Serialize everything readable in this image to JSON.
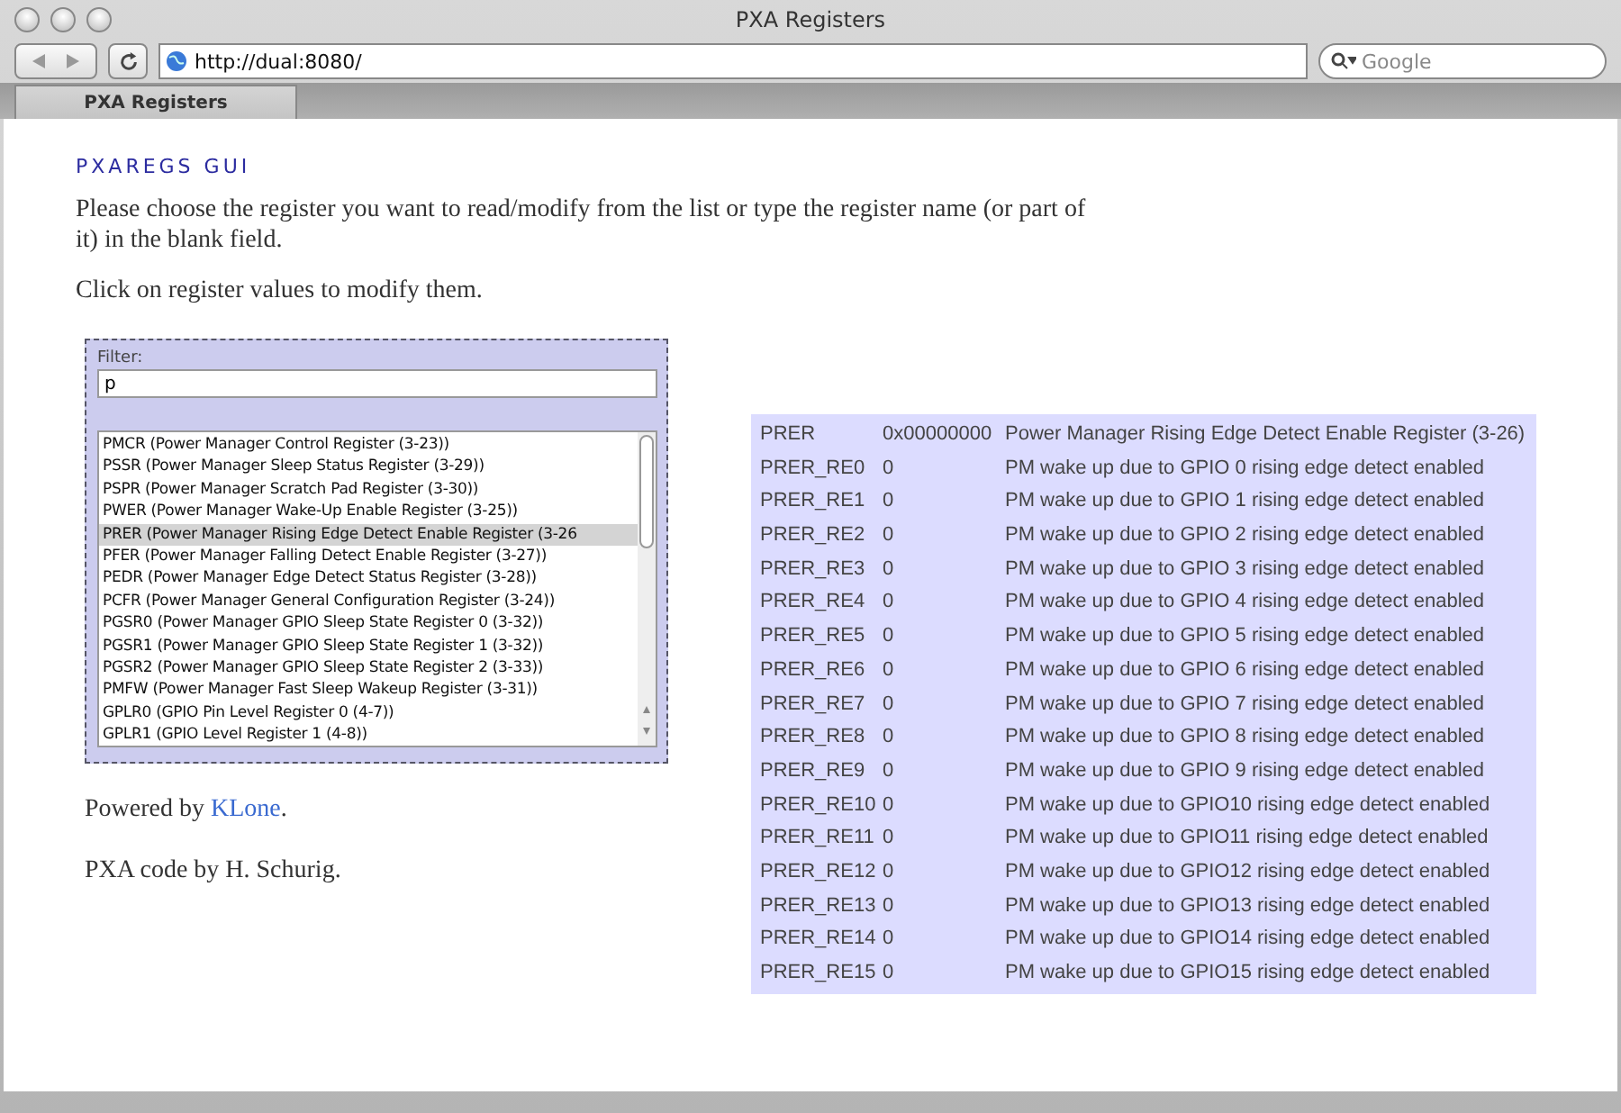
{
  "window": {
    "title": "PXA Registers"
  },
  "toolbar": {
    "url": "http://dual:8080/",
    "search": {
      "placeholder": "Google"
    }
  },
  "tabs": [
    {
      "label": "PXA Registers",
      "selected": true
    }
  ],
  "page": {
    "heading": "PXAREGS GUI",
    "paragraphs": [
      "Please choose the register you want to read/modify from the list or type the register name (or part of it) in the blank field.",
      "Click on register values to modify them."
    ],
    "filter": {
      "label": "Filter:",
      "value": "p"
    },
    "registers": [
      {
        "label": "PMCR (Power Manager Control Register (3-23))",
        "selected": false
      },
      {
        "label": "PSSR (Power Manager Sleep Status Register (3-29))",
        "selected": false
      },
      {
        "label": "PSPR (Power Manager Scratch Pad Register (3-30))",
        "selected": false
      },
      {
        "label": "PWER (Power Manager Wake-Up Enable Register (3-25))",
        "selected": false
      },
      {
        "label": "PRER (Power Manager Rising Edge Detect Enable Register (3-26",
        "selected": true
      },
      {
        "label": "PFER (Power Manager Falling Detect Enable Register (3-27))",
        "selected": false
      },
      {
        "label": "PEDR (Power Manager Edge Detect Status Register (3-28))",
        "selected": false
      },
      {
        "label": "PCFR (Power Manager General Configuration Register (3-24))",
        "selected": false
      },
      {
        "label": "PGSR0 (Power Manager GPIO Sleep State Register 0 (3-32))",
        "selected": false
      },
      {
        "label": "PGSR1 (Power Manager GPIO Sleep State Register 1 (3-32))",
        "selected": false
      },
      {
        "label": "PGSR2 (Power Manager GPIO Sleep State Register 2 (3-33))",
        "selected": false
      },
      {
        "label": "PMFW (Power Manager Fast Sleep Wakeup Register (3-31))",
        "selected": false
      },
      {
        "label": "GPLR0 (GPIO Pin Level Register 0 (4-7))",
        "selected": false
      },
      {
        "label": "GPLR1 (GPIO Level Register 1 (4-8))",
        "selected": false
      }
    ],
    "footer": [
      {
        "text": "Powered by ",
        "link": "KLone",
        "after": "."
      },
      {
        "text": "PXA code by H. Schurig."
      }
    ],
    "register_table": [
      {
        "name": "PRER",
        "value": "0x00000000",
        "description": "Power Manager Rising Edge Detect Enable Register (3-26)"
      },
      {
        "name": "PRER_RE0",
        "value": "0",
        "description": "PM wake up due to GPIO 0 rising edge detect enabled"
      },
      {
        "name": "PRER_RE1",
        "value": "0",
        "description": "PM wake up due to GPIO 1 rising edge detect enabled"
      },
      {
        "name": "PRER_RE2",
        "value": "0",
        "description": "PM wake up due to GPIO 2 rising edge detect enabled"
      },
      {
        "name": "PRER_RE3",
        "value": "0",
        "description": "PM wake up due to GPIO 3 rising edge detect enabled"
      },
      {
        "name": "PRER_RE4",
        "value": "0",
        "description": "PM wake up due to GPIO 4 rising edge detect enabled"
      },
      {
        "name": "PRER_RE5",
        "value": "0",
        "description": "PM wake up due to GPIO 5 rising edge detect enabled"
      },
      {
        "name": "PRER_RE6",
        "value": "0",
        "description": "PM wake up due to GPIO 6 rising edge detect enabled"
      },
      {
        "name": "PRER_RE7",
        "value": "0",
        "description": "PM wake up due to GPIO 7 rising edge detect enabled"
      },
      {
        "name": "PRER_RE8",
        "value": "0",
        "description": "PM wake up due to GPIO 8 rising edge detect enabled"
      },
      {
        "name": "PRER_RE9",
        "value": "0",
        "description": "PM wake up due to GPIO 9 rising edge detect enabled"
      },
      {
        "name": "PRER_RE10",
        "value": "0",
        "description": "PM wake up due to GPIO10 rising edge detect enabled"
      },
      {
        "name": "PRER_RE11",
        "value": "0",
        "description": "PM wake up due to GPIO11 rising edge detect enabled"
      },
      {
        "name": "PRER_RE12",
        "value": "0",
        "description": "PM wake up due to GPIO12 rising edge detect enabled"
      },
      {
        "name": "PRER_RE13",
        "value": "0",
        "description": "PM wake up due to GPIO13 rising edge detect enabled"
      },
      {
        "name": "PRER_RE14",
        "value": "0",
        "description": "PM wake up due to GPIO14 rising edge detect enabled"
      },
      {
        "name": "PRER_RE15",
        "value": "0",
        "description": "PM wake up due to GPIO15 rising edge detect enabled"
      }
    ]
  }
}
